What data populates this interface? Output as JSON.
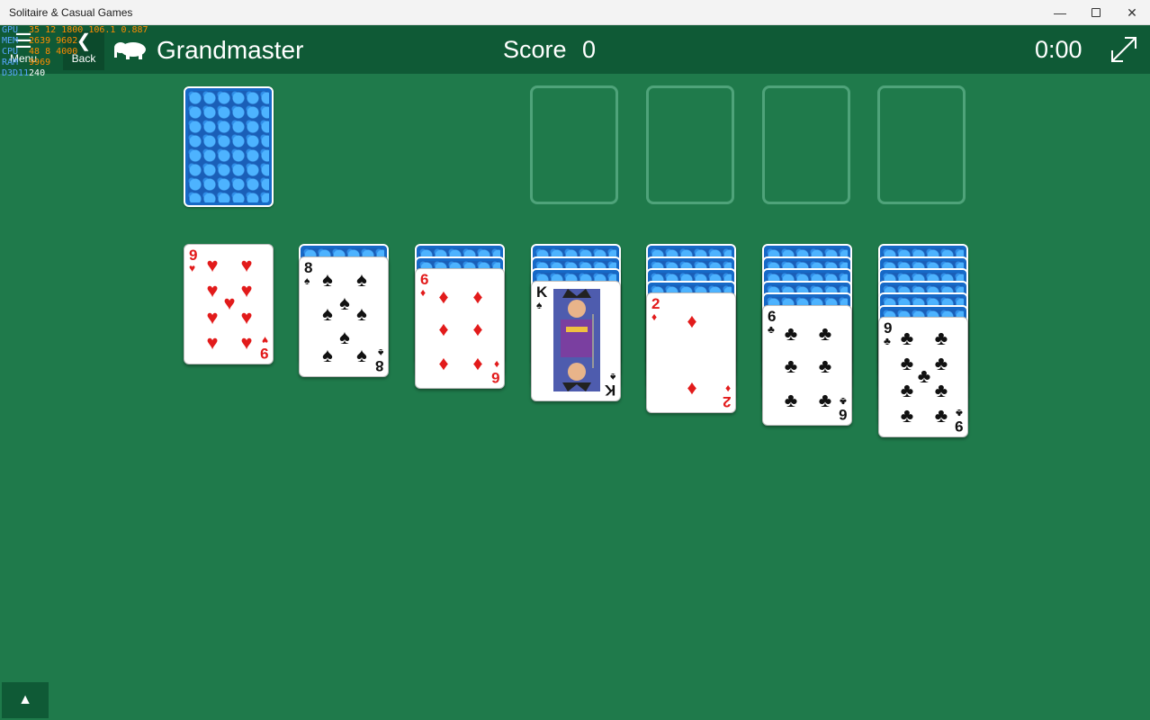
{
  "window": {
    "title": "Solitaire & Casual Games"
  },
  "header": {
    "menu_label": "Menu",
    "back_label": "Back",
    "game_title": "Grandmaster",
    "score_label": "Score",
    "score_value": "0",
    "timer": "0:00"
  },
  "perf_overlay": {
    "rows": [
      {
        "key": "GPU",
        "a": "35",
        "b": "12",
        "c": "1800",
        "d": "106.1",
        "e": "0.887"
      },
      {
        "key": "MEM",
        "a": "2639",
        "b": "9602",
        "c": "",
        "d": "",
        "e": ""
      },
      {
        "key": "CPU",
        "a": "48",
        "b": "8",
        "c": "4000",
        "d": "",
        "e": ""
      },
      {
        "key": "RAM",
        "a": "9969",
        "b": "",
        "c": "",
        "d": "",
        "e": ""
      },
      {
        "key": "D3D11",
        "a": "240",
        "b": "",
        "c": "",
        "d": "",
        "e": ""
      }
    ]
  },
  "icons": {
    "menu": "hamburger-icon",
    "back": "chevron-left-icon",
    "fullscreen": "expand-diagonal-icon",
    "tray": "caret-up-icon"
  },
  "colors": {
    "felt": "#1f7a4b",
    "header": "#0f5a36",
    "card_back": "#1669c7",
    "red_suit": "#e21b1b"
  },
  "stock": {
    "face_down": true
  },
  "foundations": [
    {
      "empty": true
    },
    {
      "empty": true
    },
    {
      "empty": true
    },
    {
      "empty": true
    }
  ],
  "tableau": [
    {
      "hidden": 0,
      "top": {
        "rank": "9",
        "suit": "♥",
        "color": "red"
      }
    },
    {
      "hidden": 1,
      "top": {
        "rank": "8",
        "suit": "♠",
        "color": "black"
      }
    },
    {
      "hidden": 2,
      "top": {
        "rank": "6",
        "suit": "♦",
        "color": "red"
      }
    },
    {
      "hidden": 3,
      "top": {
        "rank": "K",
        "suit": "♠",
        "color": "black"
      }
    },
    {
      "hidden": 4,
      "top": {
        "rank": "2",
        "suit": "♦",
        "color": "red"
      }
    },
    {
      "hidden": 5,
      "top": {
        "rank": "6",
        "suit": "♣",
        "color": "black"
      }
    },
    {
      "hidden": 6,
      "top": {
        "rank": "9",
        "suit": "♣",
        "color": "black"
      }
    }
  ]
}
